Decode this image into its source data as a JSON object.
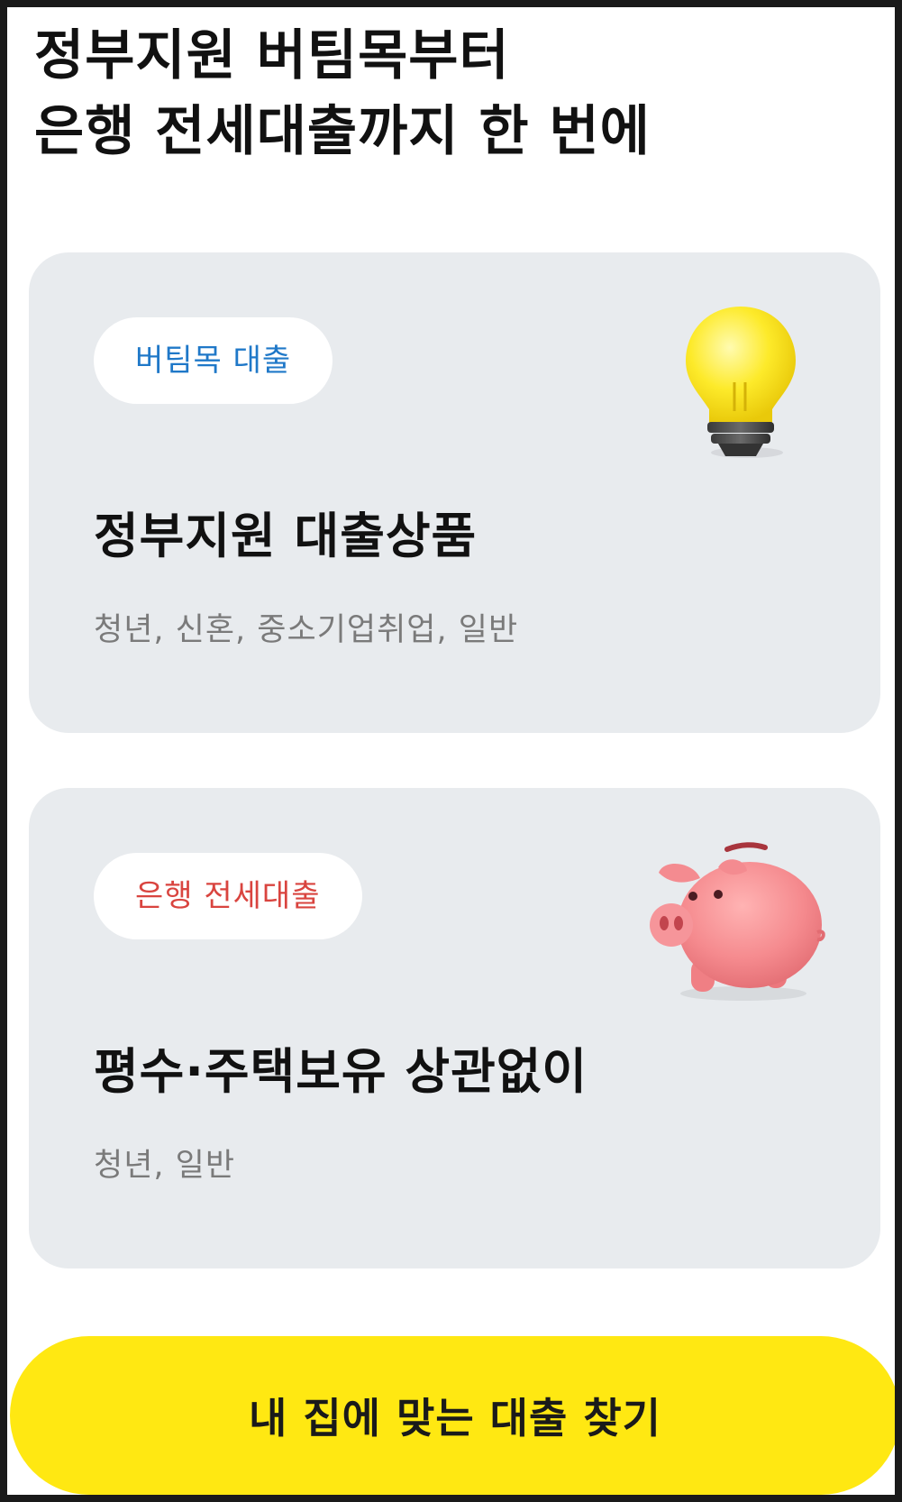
{
  "headline": {
    "line1": "정부지원 버팀목부터",
    "line2": "은행 전세대출까지 한 번에"
  },
  "cards": [
    {
      "chip": "버팀목 대출",
      "title": "정부지원 대출상품",
      "subtitle": "청년, 신혼, 중소기업취업, 일반",
      "illustration": "lightbulb-icon",
      "chip_color": "#1f78c8"
    },
    {
      "chip": "은행 전세대출",
      "title": "평수·주택보유 상관없이",
      "subtitle": "청년, 일반",
      "illustration": "piggy-bank-icon",
      "chip_color": "#d9443f"
    }
  ],
  "cta": {
    "label": "내 집에 맞는 대출 찾기",
    "color": "#ffe812"
  }
}
